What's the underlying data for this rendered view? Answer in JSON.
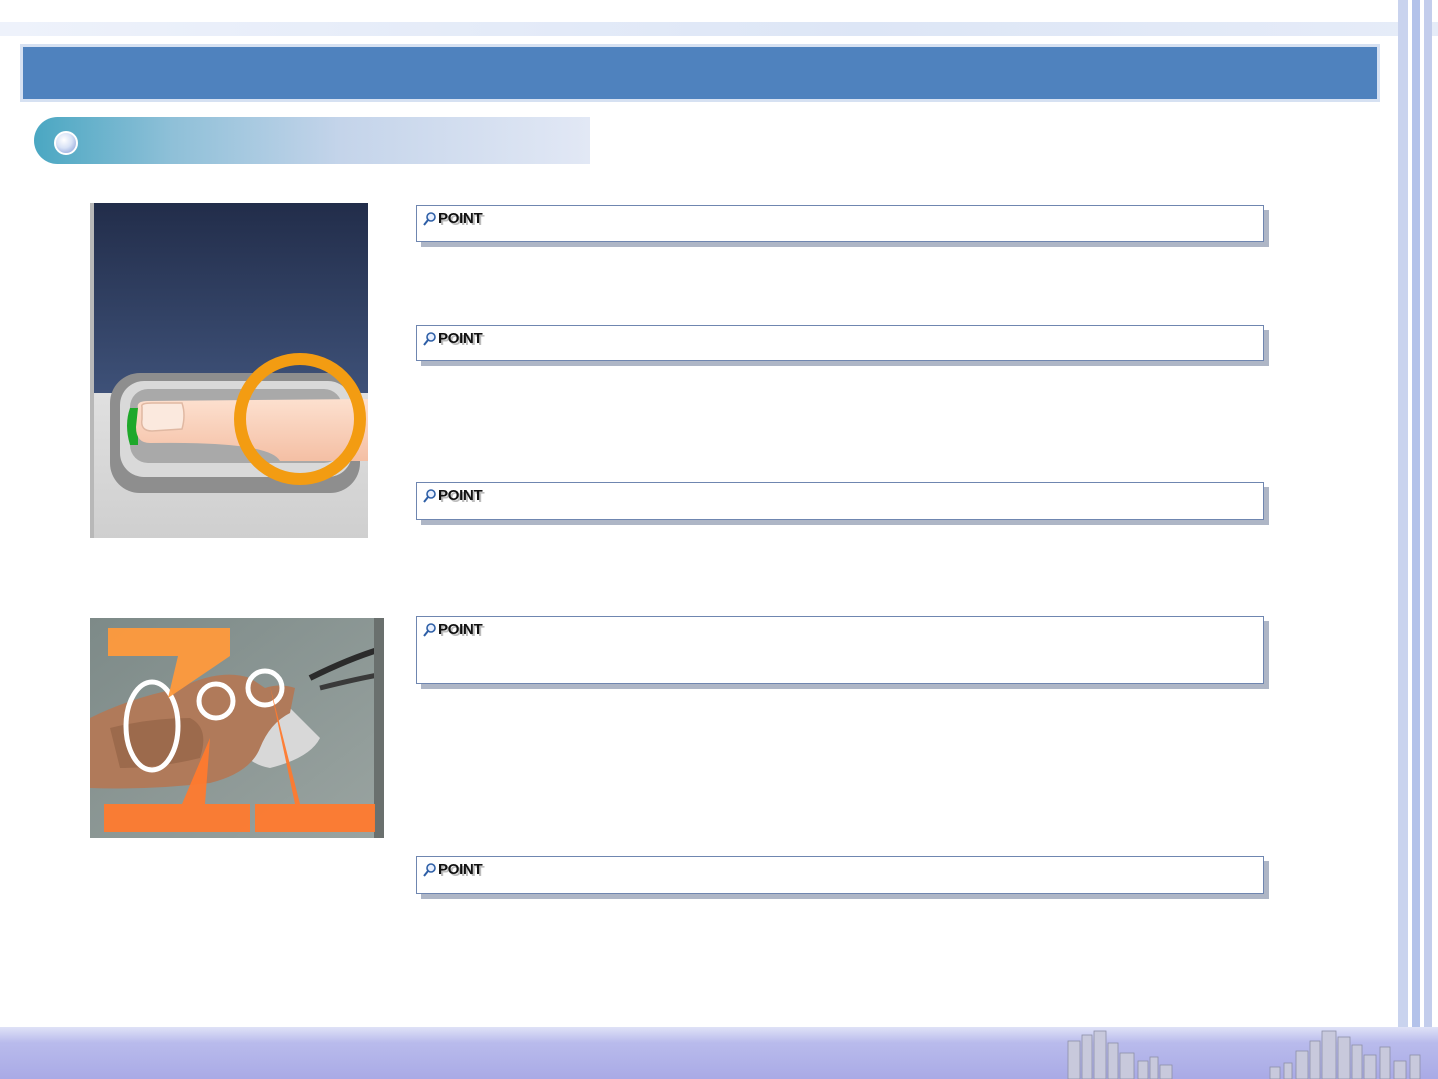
{
  "slide": {
    "title": "",
    "section_heading": ""
  },
  "points": [
    {
      "label": "POINT",
      "body": ""
    },
    {
      "label": "POINT",
      "body": ""
    },
    {
      "label": "POINT",
      "body": ""
    },
    {
      "label": "POINT",
      "body": ""
    },
    {
      "label": "POINT",
      "body": ""
    }
  ],
  "images": [
    {
      "name": "fingerprint-sensor-illustration",
      "highlight_color": "#f39c12"
    },
    {
      "name": "hand-on-sensor-photo",
      "callout_color": "#ff8a3d"
    }
  ],
  "colors": {
    "title_bar": "#4f82be",
    "section_tab_start": "#4aa7c2",
    "section_tab_end": "#e2e8f5",
    "point_border": "#6f86b0",
    "bottom_band": "#a9aae6"
  }
}
